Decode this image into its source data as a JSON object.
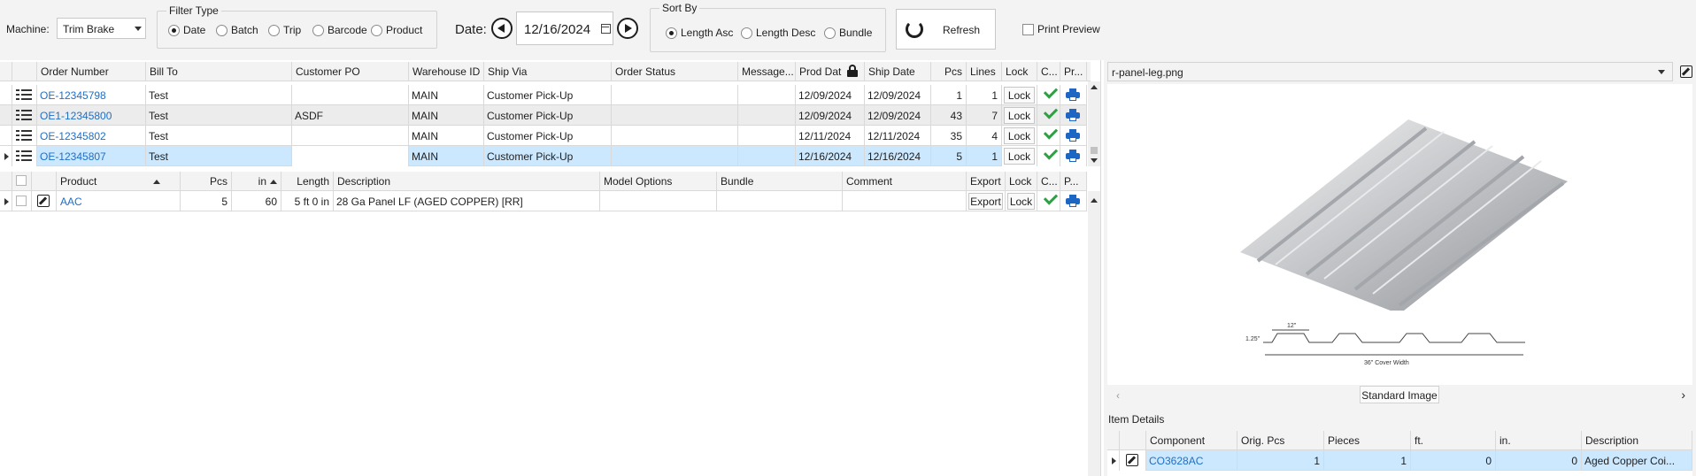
{
  "toolbar": {
    "machine_label": "Machine:",
    "machine_value": "Trim Brake",
    "filter_type": {
      "title": "Filter Type",
      "options": [
        "Date",
        "Batch",
        "Trip",
        "Barcode",
        "Product"
      ],
      "selected": "Date"
    },
    "date_label": "Date:",
    "date_value": "12/16/2024",
    "sort_by": {
      "title": "Sort By",
      "options": [
        "Length Asc",
        "Length Desc",
        "Bundle"
      ],
      "selected": "Length Asc"
    },
    "refresh_label": "Refresh",
    "print_preview_label": "Print Preview",
    "print_preview_checked": false
  },
  "orders": {
    "columns": [
      "Order Number",
      "Bill To",
      "Customer PO",
      "Warehouse ID",
      "Ship Via",
      "Order Status",
      "Message...",
      "Prod Dat",
      "Ship Date",
      "Pcs",
      "Lines",
      "Lock",
      "C...",
      "Pr..."
    ],
    "rows": [
      {
        "order": "OE-12345798",
        "bill_to": "Test",
        "po": "",
        "warehouse": "MAIN",
        "ship_via": "Customer Pick-Up",
        "status": "",
        "message": "",
        "prod_date": "12/09/2024",
        "ship_date": "12/09/2024",
        "pcs": "1",
        "lines": "1",
        "lock": "Lock"
      },
      {
        "order": "OE1-12345800",
        "bill_to": "Test",
        "po": "ASDF",
        "warehouse": "MAIN",
        "ship_via": "Customer Pick-Up",
        "status": "",
        "message": "",
        "prod_date": "12/09/2024",
        "ship_date": "12/09/2024",
        "pcs": "43",
        "lines": "7",
        "lock": "Lock"
      },
      {
        "order": "OE-12345802",
        "bill_to": "Test",
        "po": "",
        "warehouse": "MAIN",
        "ship_via": "Customer Pick-Up",
        "status": "",
        "message": "",
        "prod_date": "12/11/2024",
        "ship_date": "12/11/2024",
        "pcs": "35",
        "lines": "4",
        "lock": "Lock"
      },
      {
        "order": "OE-12345807",
        "bill_to": "Test",
        "po": "",
        "warehouse": "MAIN",
        "ship_via": "Customer Pick-Up",
        "status": "",
        "message": "",
        "prod_date": "12/16/2024",
        "ship_date": "12/16/2024",
        "pcs": "5",
        "lines": "1",
        "lock": "Lock"
      }
    ],
    "selected_row": 3
  },
  "lines": {
    "columns": [
      "Product",
      "Pcs",
      "in",
      "Length",
      "Description",
      "Model Options",
      "Bundle",
      "Comment",
      "Export",
      "Lock",
      "C...",
      "P..."
    ],
    "rows": [
      {
        "product": "AAC",
        "pcs": "5",
        "in": "60",
        "length": "5 ft 0 in",
        "description": "28 Ga Panel LF (AGED COPPER) [RR]",
        "model_options": "",
        "bundle": "",
        "comment": "",
        "export": "Export",
        "lock": "Lock"
      }
    ]
  },
  "image_panel": {
    "file_name": "r-panel-leg.png",
    "drawing_labels": {
      "width": "12\"",
      "height": "1.25\"",
      "cover": "36\" Cover Width"
    },
    "image_type": "Standard Image"
  },
  "item_details": {
    "title": "Item Details",
    "columns": [
      "Component",
      "Orig. Pcs",
      "Pieces",
      "ft.",
      "in.",
      "Description"
    ],
    "rows": [
      {
        "component": "CO3628AC",
        "orig_pcs": "1",
        "pieces": "1",
        "ft": "0",
        "in": "0",
        "description": "Aged Copper Coi..."
      }
    ]
  },
  "colors": {
    "selection": "#cce8ff",
    "link": "#1f6fc5",
    "check_green": "#2ea043",
    "printer_blue": "#1d66c4"
  }
}
